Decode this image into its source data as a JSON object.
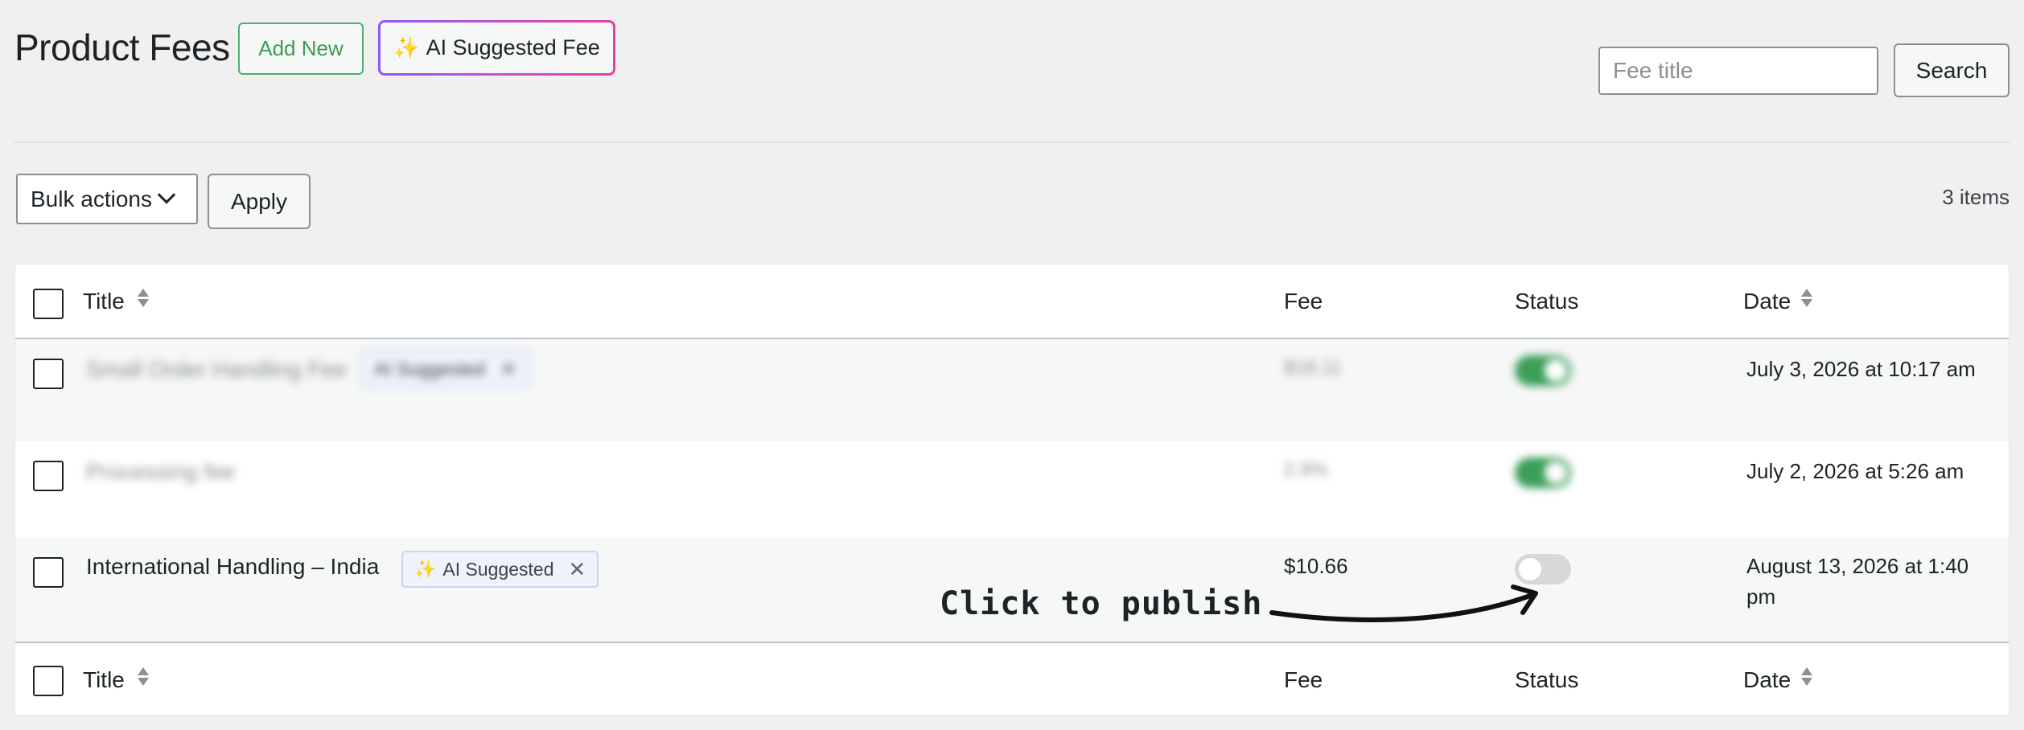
{
  "header": {
    "title": "Product Fees",
    "add_new_label": "Add New",
    "ai_fee_label": "AI Suggested Fee",
    "sparkle": "✨"
  },
  "search": {
    "placeholder": "Fee title",
    "button_label": "Search"
  },
  "toolbar": {
    "bulk_actions_label": "Bulk actions",
    "apply_label": "Apply",
    "item_count": "3 items"
  },
  "table": {
    "columns": {
      "title": "Title",
      "fee": "Fee",
      "status": "Status",
      "date": "Date"
    },
    "rows": [
      {
        "title": "Small Order Handling Fee",
        "badge": "AI Suggested",
        "fee": "$18.11",
        "status": "on",
        "date": "July 3, 2026 at 10:17 am",
        "blurred": true
      },
      {
        "title": "Processing fee",
        "badge": "",
        "fee": "2.9%",
        "status": "on",
        "date": "July 2, 2026 at 5:26 am",
        "blurred": true
      },
      {
        "title": "International Handling – India",
        "badge": "AI Suggested",
        "fee": "$10.66",
        "status": "off",
        "date_line1": "August 13, 2026 at 1:40",
        "date_line2": "pm",
        "blurred": false
      }
    ]
  },
  "annotation": {
    "text": "Click to publish"
  },
  "colors": {
    "accent_green": "#3c9e58",
    "ai_gradient_start": "#8a5cf6",
    "ai_gradient_end": "#e2449b"
  }
}
